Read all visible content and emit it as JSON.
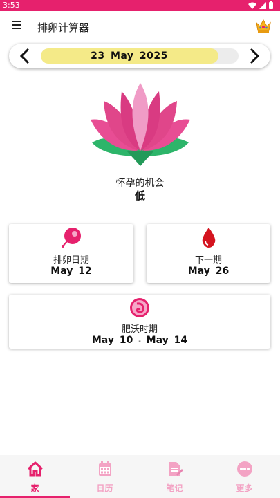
{
  "status_bar": {
    "time": "3:53"
  },
  "app_bar": {
    "title": "排卵计算器"
  },
  "date_selector": {
    "date": "23  May  2025",
    "progress_fraction": 0.9
  },
  "chance": {
    "label": "怀孕的机会",
    "value": "低"
  },
  "cards": {
    "ovulation": {
      "label": "排卵日期",
      "date": "May  12"
    },
    "next_period": {
      "label": "下一期",
      "date": "May  26"
    },
    "fertile": {
      "label": "肥沃时期",
      "start": "May  10",
      "separator": "-",
      "end": "May  14"
    }
  },
  "bottom_nav": [
    {
      "label": "家",
      "icon": "home-icon",
      "active": true
    },
    {
      "label": "日历",
      "icon": "calendar-icon",
      "active": false
    },
    {
      "label": "笔记",
      "icon": "notes-icon",
      "active": false
    },
    {
      "label": "更多",
      "icon": "more-icon",
      "active": false
    }
  ],
  "colors": {
    "accent": "#e6216d",
    "inactive_nav": "#f3a3c4",
    "date_fill": "#f4ea88",
    "lotus_pink": "#e84d94",
    "lotus_green": "#2db56a"
  }
}
